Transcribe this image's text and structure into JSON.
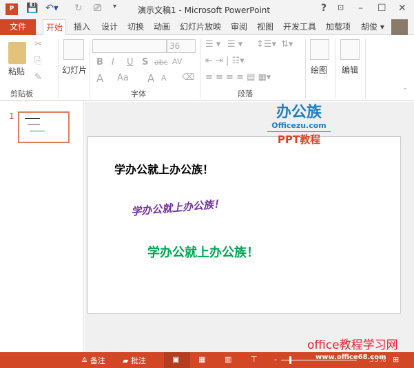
{
  "window": {
    "title": "演示文稿1 - Microsoft PowerPoint",
    "help": "?",
    "minimize": "–",
    "maximize": "☐",
    "close": "✕"
  },
  "tabs": [
    "文件",
    "开始",
    "插入",
    "设计",
    "切换",
    "动画",
    "幻灯片放映",
    "审阅",
    "视图",
    "开发工具",
    "加载项"
  ],
  "user": "胡俊 ▾",
  "ribbon": {
    "clipboard": {
      "paste": "粘贴",
      "group": "剪贴板"
    },
    "slides": {
      "new_slide": "幻灯片",
      "group": "幻灯片"
    },
    "font": {
      "font_name": "",
      "font_size": "36",
      "bold": "B",
      "italic": "I",
      "underline": "U",
      "shadow": "S",
      "strike": "abc",
      "spacing": "AV",
      "color": "A",
      "case": "Aa",
      "grow": "A",
      "shrink": "A",
      "group": "字体"
    },
    "paragraph": {
      "group": "段落"
    },
    "drawing": {
      "label": "绘图"
    },
    "editing": {
      "label": "编辑"
    }
  },
  "thumbnail": {
    "number": "1"
  },
  "slide": {
    "logo_main": "办公族",
    "logo_sub": "Officezu.com",
    "logo_tag": "PPT教程",
    "lines": [
      {
        "text": "学办公就上办公族！",
        "color": "#000000"
      },
      {
        "text": "学办公就上办公族！",
        "color": "#7030a0"
      },
      {
        "text": "学办公就上办公族！",
        "color": "#00a651"
      }
    ]
  },
  "watermark": {
    "site": "office教程学习网",
    "url": "www.office68.com"
  },
  "status": {
    "notes": "备注",
    "comments": "批注",
    "zoom": "33%"
  },
  "colors": {
    "accent": "#d24726"
  }
}
